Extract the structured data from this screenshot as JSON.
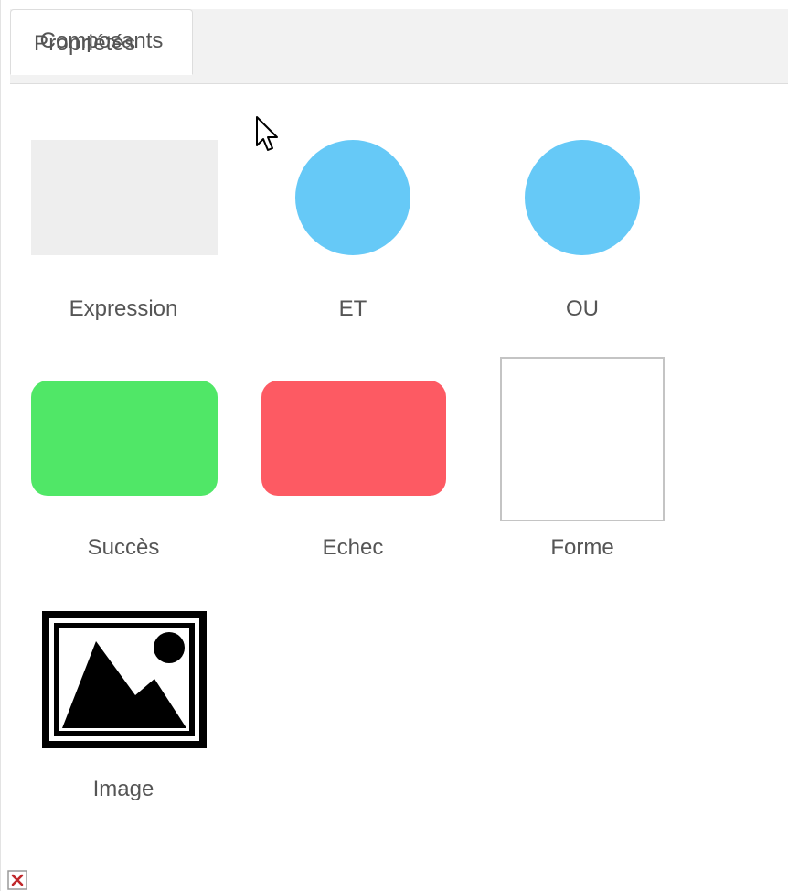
{
  "tabs": {
    "properties": "Propriétés",
    "components": "Composants"
  },
  "components": [
    {
      "label": "Expression",
      "shape": "rectangle",
      "color": "#eeeeee"
    },
    {
      "label": "ET",
      "shape": "circle",
      "color": "#66c9f7"
    },
    {
      "label": "OU",
      "shape": "circle",
      "color": "#66c9f7"
    },
    {
      "label": "Succès",
      "shape": "rounded-rectangle",
      "color": "#50e767"
    },
    {
      "label": "Echec",
      "shape": "rounded-rectangle",
      "color": "#fd5a63"
    },
    {
      "label": "Forme",
      "shape": "outlined-square",
      "color": "#c4c4c4"
    },
    {
      "label": "Image",
      "shape": "image-icon",
      "color": "#000000"
    }
  ],
  "icons": {
    "cursor": "mouse-pointer-icon",
    "broken_image": "broken-image-icon"
  }
}
